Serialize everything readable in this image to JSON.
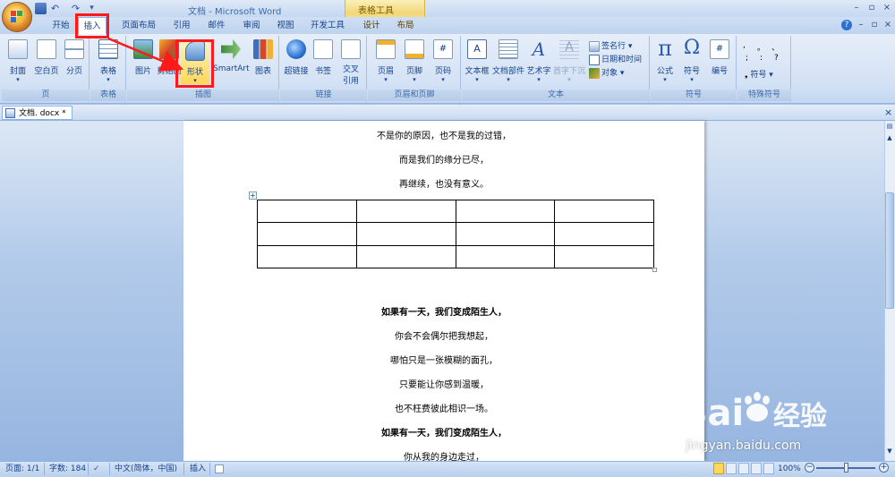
{
  "window": {
    "title": "文档 - Microsoft Word",
    "contextual_tab_group": "表格工具",
    "controls": {
      "help": "?",
      "minimize": "–",
      "restore": "▫",
      "close": "×"
    }
  },
  "tabs": [
    {
      "label": "开始"
    },
    {
      "label": "插入",
      "active": true
    },
    {
      "label": "页面布局"
    },
    {
      "label": "引用"
    },
    {
      "label": "邮件"
    },
    {
      "label": "审阅"
    },
    {
      "label": "视图"
    },
    {
      "label": "开发工具"
    },
    {
      "label": "设计",
      "contextual": true
    },
    {
      "label": "布局",
      "contextual": true
    }
  ],
  "ribbon": {
    "groups": {
      "pages": "页",
      "tables": "表格",
      "illustrations": "插图",
      "links": "链接",
      "header_footer": "页眉和页脚",
      "text": "文本",
      "symbols": "符号",
      "special_symbols": "特殊符号"
    },
    "buttons": {
      "cover": "封面",
      "blank_page": "空白页",
      "page_break": "分页",
      "table": "表格",
      "picture": "图片",
      "clip_art": "剪贴画",
      "shapes": "形状",
      "smartart": "SmartArt",
      "chart": "图表",
      "hyperlink": "超链接",
      "bookmark": "书签",
      "cross_ref_1": "交叉",
      "cross_ref_2": "引用",
      "header": "页眉",
      "footer": "页脚",
      "page_number": "页码",
      "textbox": "文本框",
      "quick_parts": "文档部件",
      "wordart": "艺术字",
      "dropcap": "首字下沉",
      "signature_line": "签名行",
      "date_time": "日期和时间",
      "object": "对象",
      "equation": "公式",
      "symbol": "符号",
      "numbering": "编号",
      "special_symbol": "符号"
    },
    "special_chars": [
      ",",
      "。",
      "、",
      ";",
      ":",
      "?"
    ]
  },
  "document_tab": {
    "label": "文档. docx *"
  },
  "document": {
    "lines_top": [
      {
        "text": "不是你的原因，也不是我的过错，",
        "bold": false
      },
      {
        "text": "而是我们的缘分已尽，",
        "bold": false
      },
      {
        "text": "再继续，也没有意义。",
        "bold": false
      }
    ],
    "table": {
      "rows": 3,
      "cols": 4
    },
    "lines_bottom": [
      {
        "text": "如果有一天，我们变成陌生人，",
        "bold": true
      },
      {
        "text": "你会不会偶尔把我想起，",
        "bold": false
      },
      {
        "text": "哪怕只是一张模糊的面孔，",
        "bold": false
      },
      {
        "text": "只要能让你感到温暖，",
        "bold": false
      },
      {
        "text": "也不枉费彼此相识一场。",
        "bold": false
      },
      {
        "text": "如果有一天，我们变成陌生人，",
        "bold": true
      },
      {
        "text": "你从我的身边走过，",
        "bold": false
      }
    ]
  },
  "statusbar": {
    "page": "页面: 1/1",
    "words": "字数: 184",
    "language": "中文(简体，中国)",
    "mode": "插入",
    "zoom": "100%"
  },
  "watermark": {
    "brand": "Bai 经验",
    "url": "jingyan.baidu.com"
  },
  "colors": {
    "annotation": "#ff1a1a",
    "accent": "#15428b",
    "contextual": "#f2d77a"
  }
}
